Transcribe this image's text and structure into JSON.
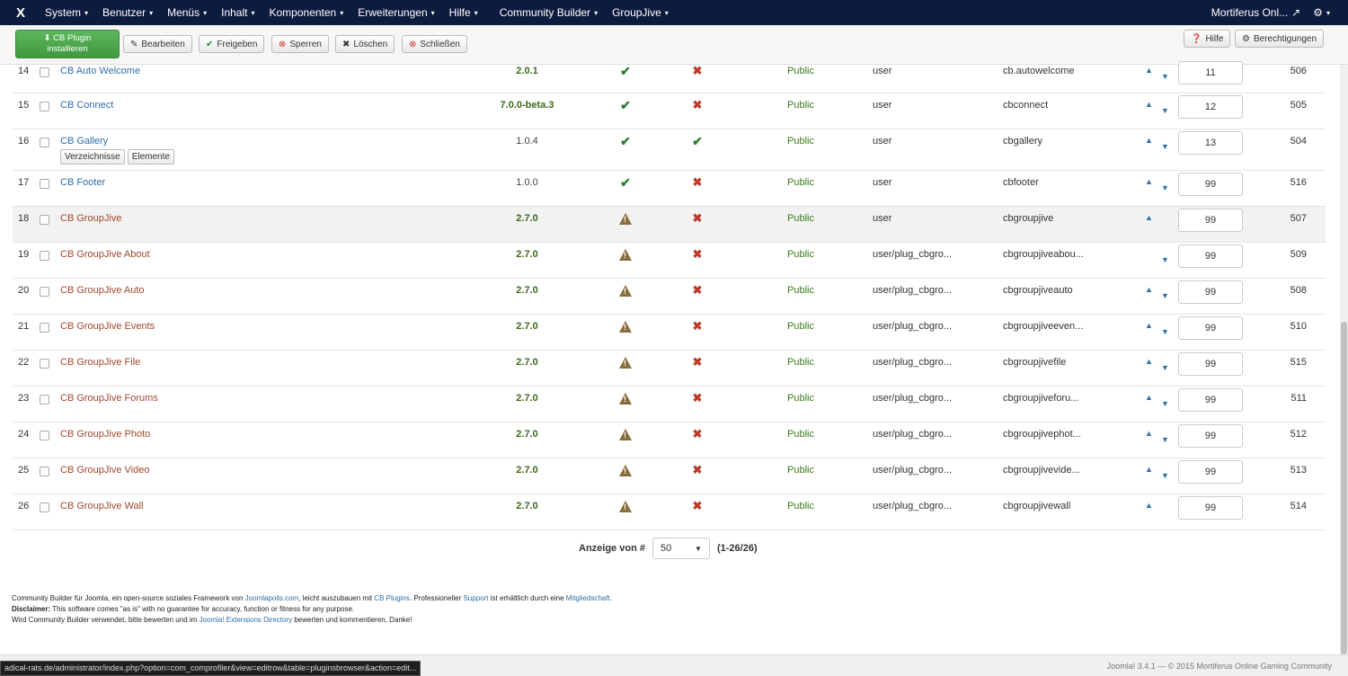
{
  "nav": {
    "logo": "X",
    "menu": [
      {
        "label": "System",
        "caret": "▾"
      },
      {
        "label": "Benutzer",
        "caret": "▾"
      },
      {
        "label": "Menüs",
        "caret": "▾"
      },
      {
        "label": "Inhalt",
        "caret": "▾"
      },
      {
        "label": "Komponenten",
        "caret": "▾"
      },
      {
        "label": "Erweiterungen",
        "caret": "▾"
      },
      {
        "label": "Hilfe",
        "caret": "▾"
      },
      {
        "label": "Community Builder",
        "caret": "▾"
      },
      {
        "label": "GroupJive",
        "caret": "▾"
      }
    ],
    "site_link": "Mortiferus Onl...",
    "gear": "⚙"
  },
  "toolbar": {
    "install_line1": "CB Plugin",
    "install_line2": "installieren",
    "edit": "Bearbeiten",
    "publish": "Freigeben",
    "unpublish": "Sperren",
    "delete": "Löschen",
    "close": "Schließen",
    "help": "Hilfe",
    "permissions": "Berechtigungen"
  },
  "rows": [
    {
      "num": "14",
      "name": "CB Auto Welcome",
      "color": "blue",
      "version": "2.0.1",
      "version_bold": true,
      "published": "check",
      "default": "cross",
      "access": "Public",
      "type": "user",
      "element": "cb.autowelcome",
      "up": true,
      "down": true,
      "order": "11",
      "id": "506"
    },
    {
      "num": "15",
      "name": "CB Connect",
      "color": "blue",
      "version": "7.0.0-beta.3",
      "version_bold": true,
      "published": "check",
      "default": "cross",
      "access": "Public",
      "type": "user",
      "element": "cbconnect",
      "up": true,
      "down": true,
      "order": "12",
      "id": "505"
    },
    {
      "num": "16",
      "name": "CB Gallery",
      "color": "blue",
      "version": "1.0.4",
      "version_bold": false,
      "published": "check",
      "default": "check",
      "access": "Public",
      "type": "user",
      "element": "cbgallery",
      "up": true,
      "down": true,
      "order": "13",
      "id": "504",
      "subbuttons": [
        "Verzeichnisse",
        "Elemente"
      ]
    },
    {
      "num": "17",
      "name": "CB Footer",
      "color": "blue",
      "version": "1.0.0",
      "version_bold": false,
      "published": "check",
      "default": "cross",
      "access": "Public",
      "type": "user",
      "element": "cbfooter",
      "up": true,
      "down": true,
      "order": "99",
      "id": "516"
    },
    {
      "num": "18",
      "name": "CB GroupJive",
      "color": "red",
      "version": "2.7.0",
      "version_bold": true,
      "published": "warn",
      "default": "cross",
      "access": "Public",
      "type": "user",
      "element": "cbgroupjive",
      "up": true,
      "down": false,
      "order": "99",
      "id": "507"
    },
    {
      "num": "19",
      "name": "CB GroupJive About",
      "color": "red",
      "version": "2.7.0",
      "version_bold": true,
      "published": "warn",
      "default": "cross",
      "access": "Public",
      "type": "user/plug_cbgro...",
      "element": "cbgroupjiveabou...",
      "up": false,
      "down": true,
      "order": "99",
      "id": "509"
    },
    {
      "num": "20",
      "name": "CB GroupJive Auto",
      "color": "red",
      "version": "2.7.0",
      "version_bold": true,
      "published": "warn",
      "default": "cross",
      "access": "Public",
      "type": "user/plug_cbgro...",
      "element": "cbgroupjiveauto",
      "up": true,
      "down": true,
      "order": "99",
      "id": "508"
    },
    {
      "num": "21",
      "name": "CB GroupJive Events",
      "color": "red",
      "version": "2.7.0",
      "version_bold": true,
      "published": "warn",
      "default": "cross",
      "access": "Public",
      "type": "user/plug_cbgro...",
      "element": "cbgroupjiveeven...",
      "up": true,
      "down": true,
      "order": "99",
      "id": "510"
    },
    {
      "num": "22",
      "name": "CB GroupJive File",
      "color": "red",
      "version": "2.7.0",
      "version_bold": true,
      "published": "warn",
      "default": "cross",
      "access": "Public",
      "type": "user/plug_cbgro...",
      "element": "cbgroupjivefile",
      "up": true,
      "down": true,
      "order": "99",
      "id": "515"
    },
    {
      "num": "23",
      "name": "CB GroupJive Forums",
      "color": "red",
      "version": "2.7.0",
      "version_bold": true,
      "published": "warn",
      "default": "cross",
      "access": "Public",
      "type": "user/plug_cbgro...",
      "element": "cbgroupjiveforu...",
      "up": true,
      "down": true,
      "order": "99",
      "id": "511"
    },
    {
      "num": "24",
      "name": "CB GroupJive Photo",
      "color": "red",
      "version": "2.7.0",
      "version_bold": true,
      "published": "warn",
      "default": "cross",
      "access": "Public",
      "type": "user/plug_cbgro...",
      "element": "cbgroupjivephot...",
      "up": true,
      "down": true,
      "order": "99",
      "id": "512"
    },
    {
      "num": "25",
      "name": "CB GroupJive Video",
      "color": "red",
      "version": "2.7.0",
      "version_bold": true,
      "published": "warn",
      "default": "cross",
      "access": "Public",
      "type": "user/plug_cbgro...",
      "element": "cbgroupjivevide...",
      "up": true,
      "down": true,
      "order": "99",
      "id": "513"
    },
    {
      "num": "26",
      "name": "CB GroupJive Wall",
      "color": "red",
      "version": "2.7.0",
      "version_bold": true,
      "published": "warn",
      "default": "cross",
      "access": "Public",
      "type": "user/plug_cbgro...",
      "element": "cbgroupjivewall",
      "up": true,
      "down": false,
      "order": "99",
      "id": "514"
    }
  ],
  "pager": {
    "label": "Anzeige von #",
    "value": "50",
    "range": "(1-26/26)"
  },
  "footer": {
    "line1_a": "Community Builder für Joomla, ein open-source soziales Framework von ",
    "line1_link1": "Joomlapolis.com",
    "line1_b": ", leicht auszubauen mit ",
    "line1_link2": "CB Plugins",
    "line1_c": ". Professioneller ",
    "line1_link3": "Support",
    "line1_d": " ist erhältlich durch eine ",
    "line1_link4": "Mitgliedschaft",
    "line1_e": ".",
    "disclaimer_label": "Disclaimer:",
    "disclaimer_text": " This software comes \"as is\" with no guarantee for accuracy, function or fitness for any purpose.",
    "line3_a": "Wird Community Builder verwendet, bitte bewerten und im ",
    "line3_link": "Joomla! Extensions Directory",
    "line3_b": " bewerten und kommentieren, Danke!"
  },
  "bottom": {
    "version": "Joomla! 3.4.1  —  © 2015 Mortiferus Online Gaming Community",
    "status_url": "adical-rats.de/administrator/index.php?option=com_comprofiler&view=editrow&table=pluginsbrowser&action=edit..."
  }
}
